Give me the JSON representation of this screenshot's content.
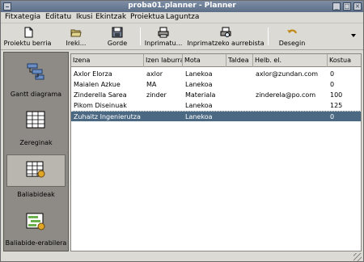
{
  "window": {
    "title": "proba01.planner - Planner"
  },
  "menubar": {
    "items": [
      "Fitxategia",
      "Editatu",
      "Ikusi",
      "Ekintzak",
      "Proiektua",
      "Laguntza"
    ]
  },
  "toolbar": {
    "buttons": [
      {
        "label": "Proiektu berria",
        "icon": "new-document-icon"
      },
      {
        "label": "Ireki...",
        "icon": "open-folder-icon"
      },
      {
        "label": "Gorde",
        "icon": "save-disk-icon"
      },
      {
        "label": "Inprimatu...",
        "icon": "printer-icon"
      },
      {
        "label": "Inprimatzeko aurrebista",
        "icon": "print-preview-icon"
      },
      {
        "label": "Desegin",
        "icon": "undo-icon"
      }
    ]
  },
  "sidebar": {
    "items": [
      {
        "label": "Gantt diagrama",
        "icon": "gantt-chart-icon"
      },
      {
        "label": "Zereginak",
        "icon": "task-list-icon"
      },
      {
        "label": "Baliabideak",
        "icon": "resources-icon",
        "active": true
      },
      {
        "label": "Baliabide-erabilera",
        "icon": "resource-usage-icon"
      }
    ]
  },
  "table": {
    "columns": [
      "Izena",
      "Izen laburra",
      "Mota",
      "Taldea",
      "Helb. el.",
      "Kostua"
    ],
    "rows": [
      {
        "izena": "Axlor Elorza",
        "izen_laburra": "axlor",
        "mota": "Lanekoa",
        "taldea": "",
        "helb": "axlor@zundan.com",
        "kostua": "0"
      },
      {
        "izena": "Maialen Azkue",
        "izen_laburra": "MA",
        "mota": "Lanekoa",
        "taldea": "",
        "helb": "",
        "kostua": "0"
      },
      {
        "izena": "Zinderella Sarea",
        "izen_laburra": "zinder",
        "mota": "Materiala",
        "taldea": "",
        "helb": "zinderela@po.com",
        "kostua": "100"
      },
      {
        "izena": "Pikom Diseinuak",
        "izen_laburra": "",
        "mota": "Lanekoa",
        "taldea": "",
        "helb": "",
        "kostua": "125"
      },
      {
        "izena": "Zuhaitz Ingenierutza",
        "izen_laburra": "",
        "mota": "Lanekoa",
        "taldea": "",
        "helb": "",
        "kostua": "0",
        "selected": true
      }
    ]
  },
  "colors": {
    "selection": "#4b6983",
    "sidebar_bg": "#8e8b86",
    "titlebar": "#6b7d95"
  }
}
